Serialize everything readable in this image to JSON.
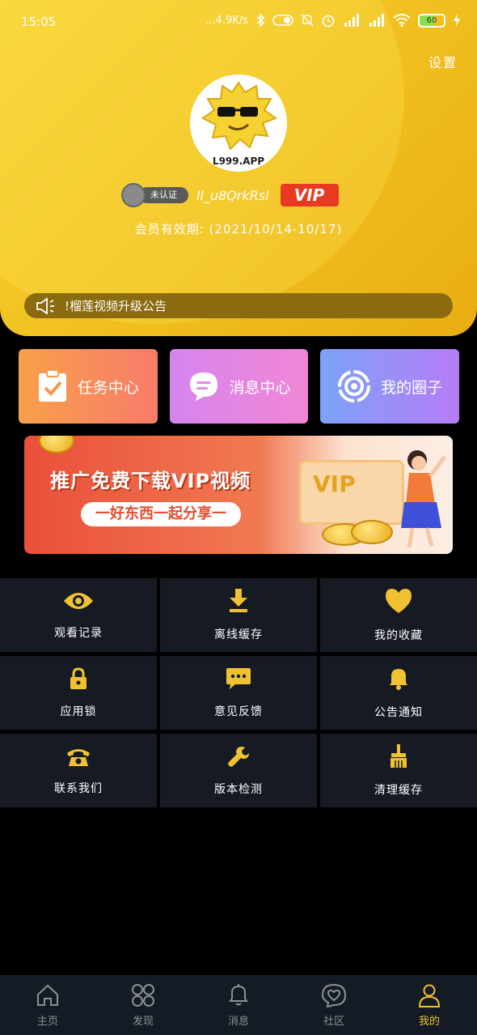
{
  "status_bar": {
    "time": "15:05",
    "network_speed": "...4.9K/s",
    "battery": "60"
  },
  "header": {
    "settings_label": "设置",
    "avatar_caption": "L999.APP",
    "verify_label": "未认证",
    "username": "ll_u8QrkRsl",
    "vip_label": "VIP",
    "membership_text": "会员有效期: (2021/10/14-10/17)",
    "notice_text": "!榴莲视频升级公告"
  },
  "cards": [
    {
      "label": "任务中心",
      "icon": "clipboard-check-icon"
    },
    {
      "label": "消息中心",
      "icon": "chat-bubble-icon"
    },
    {
      "label": "我的圈子",
      "icon": "circle-target-icon"
    }
  ],
  "banner": {
    "title": "推广免费下载VIP视频",
    "subtitle": "一好东西一起分享一",
    "vip_text": "VIP"
  },
  "menu": [
    {
      "label": "观看记录",
      "icon": "eye-icon"
    },
    {
      "label": "离线缓存",
      "icon": "download-icon"
    },
    {
      "label": "我的收藏",
      "icon": "heart-icon"
    },
    {
      "label": "应用锁",
      "icon": "lock-icon"
    },
    {
      "label": "意见反馈",
      "icon": "feedback-icon"
    },
    {
      "label": "公告通知",
      "icon": "bell-icon"
    },
    {
      "label": "联系我们",
      "icon": "telephone-icon"
    },
    {
      "label": "版本检测",
      "icon": "wrench-icon"
    },
    {
      "label": "清理缓存",
      "icon": "broom-icon"
    }
  ],
  "tabs": [
    {
      "label": "主页",
      "icon": "home-icon"
    },
    {
      "label": "发现",
      "icon": "discover-icon"
    },
    {
      "label": "消息",
      "icon": "bell-icon"
    },
    {
      "label": "社区",
      "icon": "community-icon"
    },
    {
      "label": "我的",
      "icon": "user-icon"
    }
  ],
  "colors": {
    "accent": "#f0c233",
    "header": "#f2c322",
    "tile_bg": "#161a22",
    "tabbar_bg": "#151b24",
    "vip_red": "#e83a20"
  }
}
